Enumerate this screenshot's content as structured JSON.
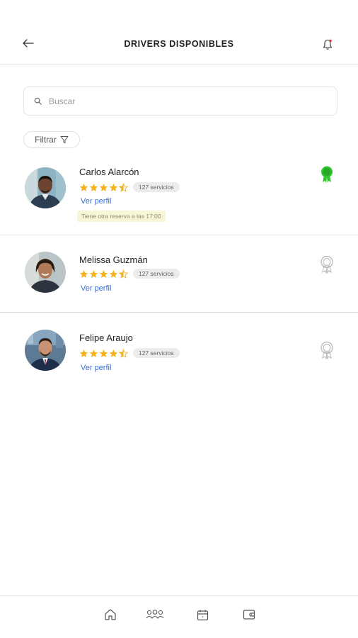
{
  "header": {
    "title": "DRIVERS DISPONIBLES",
    "back_icon": "arrow-left-icon",
    "notification_icon": "bell-icon"
  },
  "search": {
    "placeholder": "Buscar",
    "value": ""
  },
  "filter": {
    "label": "Filtrar",
    "icon": "funnel-icon"
  },
  "colors": {
    "star": "#f5b21b",
    "link": "#3b6fd4",
    "award_active": "#2ec52e",
    "award_inactive": "#b5b5b5",
    "note_bg": "#f8f6d8"
  },
  "drivers": [
    {
      "name": "Carlos Alarcón",
      "rating": 4.5,
      "services": "127 servicios",
      "profile_link": "Ver perfil",
      "note": "Tiene otra reserva a las 17:00",
      "award_state": "active"
    },
    {
      "name": "Melissa Guzmán",
      "rating": 4.5,
      "services": "127 servicios",
      "profile_link": "Ver perfil",
      "award_state": "inactive"
    },
    {
      "name": "Felipe Araujo",
      "rating": 4.5,
      "services": "127 servicios",
      "profile_link": "Ver perfil",
      "award_state": "inactive"
    }
  ],
  "bottom_nav": [
    {
      "icon": "home-icon"
    },
    {
      "icon": "users-icon"
    },
    {
      "icon": "calendar-icon"
    },
    {
      "icon": "wallet-icon"
    }
  ]
}
